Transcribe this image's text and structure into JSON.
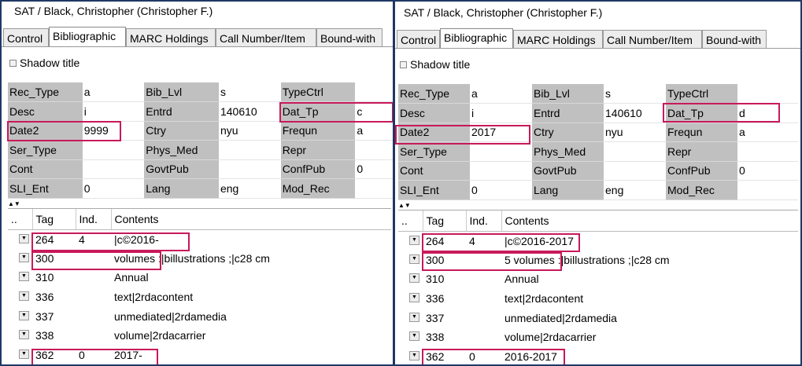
{
  "highlight_color": "#c8195b",
  "left": {
    "title": "SAT / Black, Christopher (Christopher F.)",
    "tabs": [
      "Control",
      "Bibliographic",
      "MARC Holdings",
      "Call Number/Item",
      "Bound-with"
    ],
    "active_tab": "Bibliographic",
    "shadow_label": "Shadow title",
    "fixed_fields": [
      [
        {
          "l": "Rec_Type",
          "v": "a"
        },
        {
          "l": "Bib_Lvl",
          "v": "s"
        },
        {
          "l": "TypeCtrl",
          "v": ""
        }
      ],
      [
        {
          "l": "Desc",
          "v": "i"
        },
        {
          "l": "Entrd",
          "v": "140610"
        },
        {
          "l": "Dat_Tp",
          "v": "c"
        }
      ],
      [
        {
          "l": "Date2",
          "v": "9999"
        },
        {
          "l": "Ctry",
          "v": "nyu"
        },
        {
          "l": "Frequn",
          "v": "a"
        }
      ],
      [
        {
          "l": "Ser_Type",
          "v": ""
        },
        {
          "l": "Phys_Med",
          "v": ""
        },
        {
          "l": "Repr",
          "v": ""
        }
      ],
      [
        {
          "l": "Cont",
          "v": ""
        },
        {
          "l": "GovtPub",
          "v": ""
        },
        {
          "l": "ConfPub",
          "v": "0"
        }
      ],
      [
        {
          "l": "SLI_Ent",
          "v": "0"
        },
        {
          "l": "Lang",
          "v": "eng"
        },
        {
          "l": "Mod_Rec",
          "v": ""
        }
      ]
    ],
    "headers": [
      "..",
      "Tag",
      "Ind.",
      "Contents"
    ],
    "rows": [
      {
        "tag": "264",
        "ind": "4",
        "contents": "|c©2016-"
      },
      {
        "tag": "300",
        "ind": "",
        "contents": "volumes :|billustrations ;|c28 cm"
      },
      {
        "tag": "310",
        "ind": "",
        "contents": "Annual"
      },
      {
        "tag": "336",
        "ind": "",
        "contents": "text|2rdacontent"
      },
      {
        "tag": "337",
        "ind": "",
        "contents": "unmediated|2rdamedia"
      },
      {
        "tag": "338",
        "ind": "",
        "contents": "volume|2rdacarrier"
      },
      {
        "tag": "362",
        "ind": "0",
        "contents": "2017-"
      }
    ]
  },
  "right": {
    "title": "SAT / Black, Christopher (Christopher F.)",
    "tabs": [
      "Control",
      "Bibliographic",
      "MARC Holdings",
      "Call Number/Item",
      "Bound-with"
    ],
    "active_tab": "Bibliographic",
    "shadow_label": "Shadow title",
    "fixed_fields": [
      [
        {
          "l": "Rec_Type",
          "v": "a"
        },
        {
          "l": "Bib_Lvl",
          "v": "s"
        },
        {
          "l": "TypeCtrl",
          "v": ""
        }
      ],
      [
        {
          "l": "Desc",
          "v": "i"
        },
        {
          "l": "Entrd",
          "v": "140610"
        },
        {
          "l": "Dat_Tp",
          "v": "d"
        }
      ],
      [
        {
          "l": "Date2",
          "v": "2017"
        },
        {
          "l": "Ctry",
          "v": "nyu"
        },
        {
          "l": "Frequn",
          "v": "a"
        }
      ],
      [
        {
          "l": "Ser_Type",
          "v": ""
        },
        {
          "l": "Phys_Med",
          "v": ""
        },
        {
          "l": "Repr",
          "v": ""
        }
      ],
      [
        {
          "l": "Cont",
          "v": ""
        },
        {
          "l": "GovtPub",
          "v": ""
        },
        {
          "l": "ConfPub",
          "v": "0"
        }
      ],
      [
        {
          "l": "SLI_Ent",
          "v": "0"
        },
        {
          "l": "Lang",
          "v": "eng"
        },
        {
          "l": "Mod_Rec",
          "v": ""
        }
      ]
    ],
    "headers": [
      "..",
      "Tag",
      "Ind.",
      "Contents"
    ],
    "rows": [
      {
        "tag": "264",
        "ind": "4",
        "contents": "|c©2016-2017"
      },
      {
        "tag": "300",
        "ind": "",
        "contents": "5 volumes :|billustrations ;|c28 cm"
      },
      {
        "tag": "310",
        "ind": "",
        "contents": "Annual"
      },
      {
        "tag": "336",
        "ind": "",
        "contents": "text|2rdacontent"
      },
      {
        "tag": "337",
        "ind": "",
        "contents": "unmediated|2rdamedia"
      },
      {
        "tag": "338",
        "ind": "",
        "contents": "volume|2rdacarrier"
      },
      {
        "tag": "362",
        "ind": "0",
        "contents": "2016-2017"
      }
    ]
  }
}
